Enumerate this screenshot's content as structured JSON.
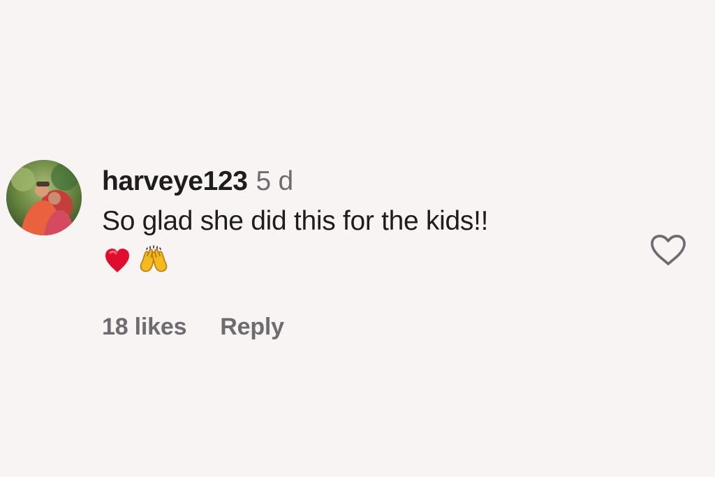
{
  "comment": {
    "username": "harveye123",
    "time": "5 d",
    "text": "So glad she did this for the kids!!",
    "emoji": [
      "red-heart",
      "raising-hands"
    ],
    "likes": "18 likes",
    "reply": "Reply"
  },
  "colors": {
    "background": "#f8f4f3",
    "primary_text": "#1f1c1d",
    "secondary_text": "#6e6c70",
    "heart_emoji": "#e00d2d",
    "hands_emoji": "#f4b91d"
  },
  "icons": {
    "like": "heart-outline-icon",
    "avatar": "profile-photo"
  }
}
